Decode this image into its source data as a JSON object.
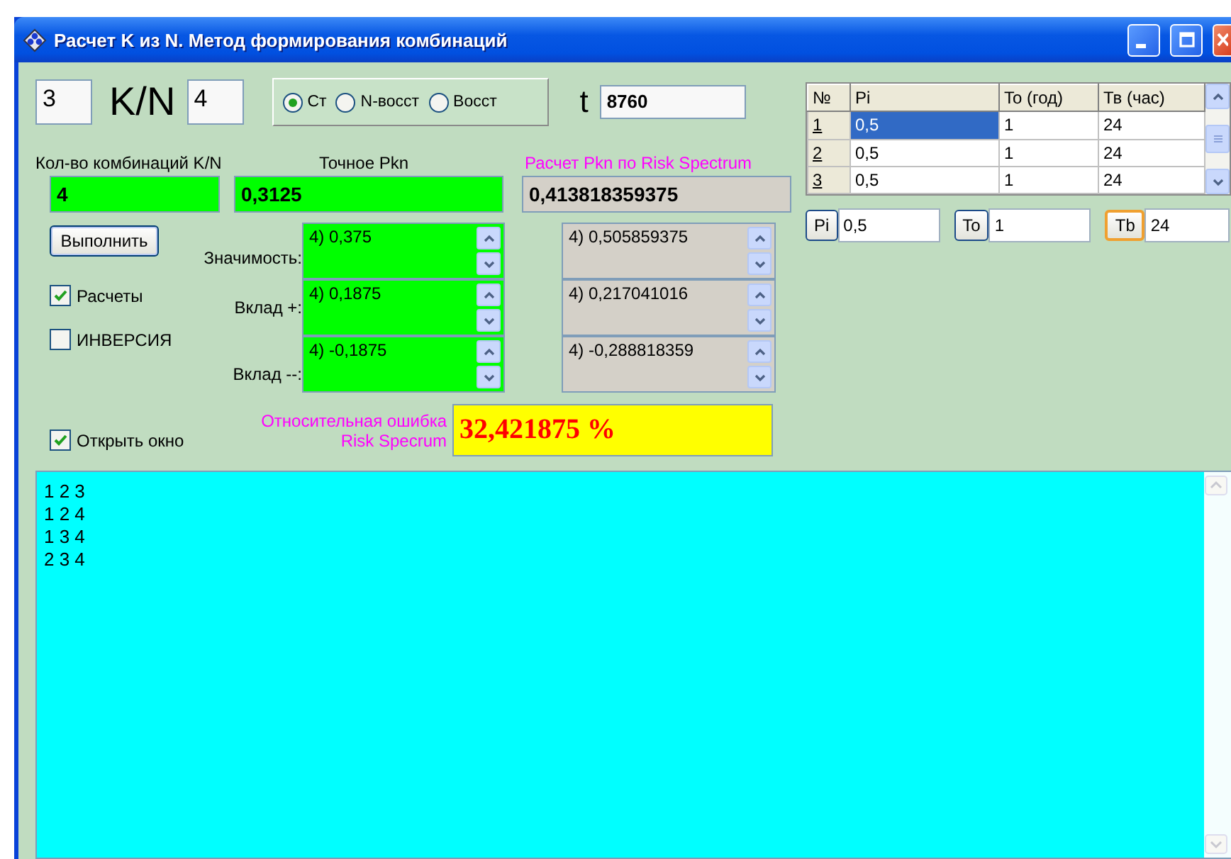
{
  "window": {
    "title": "Расчет K из N. Метод формирования комбинаций"
  },
  "k_field": {
    "value": "3"
  },
  "kn_label": "K/N",
  "n_field": {
    "value": "4"
  },
  "mode_options": [
    {
      "label": "Ст",
      "selected": true
    },
    {
      "label": "N-восст",
      "selected": false
    },
    {
      "label": "Восст",
      "selected": false
    }
  ],
  "t_field": {
    "label": "t",
    "value": "8760"
  },
  "results": [
    {
      "kind": "calc",
      "label": "Кол-во комбинаций K/N",
      "value": "4"
    },
    {
      "kind": "calc",
      "label": "Точное Pkn",
      "value": "0,3125"
    },
    {
      "kind": "risk",
      "label": "Расчет Pkn  по Risk Spectrum",
      "value": "0,413818359375"
    }
  ],
  "run_button": "Выполнить",
  "checkboxes": [
    {
      "label": "Расчеты",
      "checked": true
    },
    {
      "label": "ИНВЕРСИЯ",
      "checked": false
    }
  ],
  "metrics": [
    {
      "label": "Значимость:",
      "exact": "4) 0,375",
      "risk": "4) 0,505859375"
    },
    {
      "label": "Вклад +:",
      "exact": "4) 0,1875",
      "risk": "4) 0,217041016"
    },
    {
      "label": "Вклад --:",
      "exact": "4) -0,1875",
      "risk": "4) -0,288818359"
    }
  ],
  "open_window": {
    "label": "Открыть окно",
    "checked": true
  },
  "error": {
    "label": "Относительная ошибка\nRisk Specrum",
    "value": "32,421875 %"
  },
  "table": {
    "columns": [
      "№",
      "Pi",
      "To (год)",
      "Тв (час)"
    ],
    "rows": [
      {
        "cells": [
          "1",
          "0,5",
          "1",
          "24"
        ],
        "selected": true
      },
      {
        "cells": [
          "2",
          "0,5",
          "1",
          "24"
        ],
        "selected": false
      },
      {
        "cells": [
          "3",
          "0,5",
          "1",
          "24"
        ],
        "selected": false
      }
    ]
  },
  "param_buttons": [
    {
      "label": "Pi",
      "value": "0,5",
      "focused": false
    },
    {
      "label": "To",
      "value": "1",
      "focused": false
    },
    {
      "label": "Tb",
      "value": "24",
      "focused": true
    }
  ],
  "output": {
    "lines": [
      "1 2 3",
      "1 2 4",
      "1 3 4",
      "2 3 4"
    ]
  }
}
